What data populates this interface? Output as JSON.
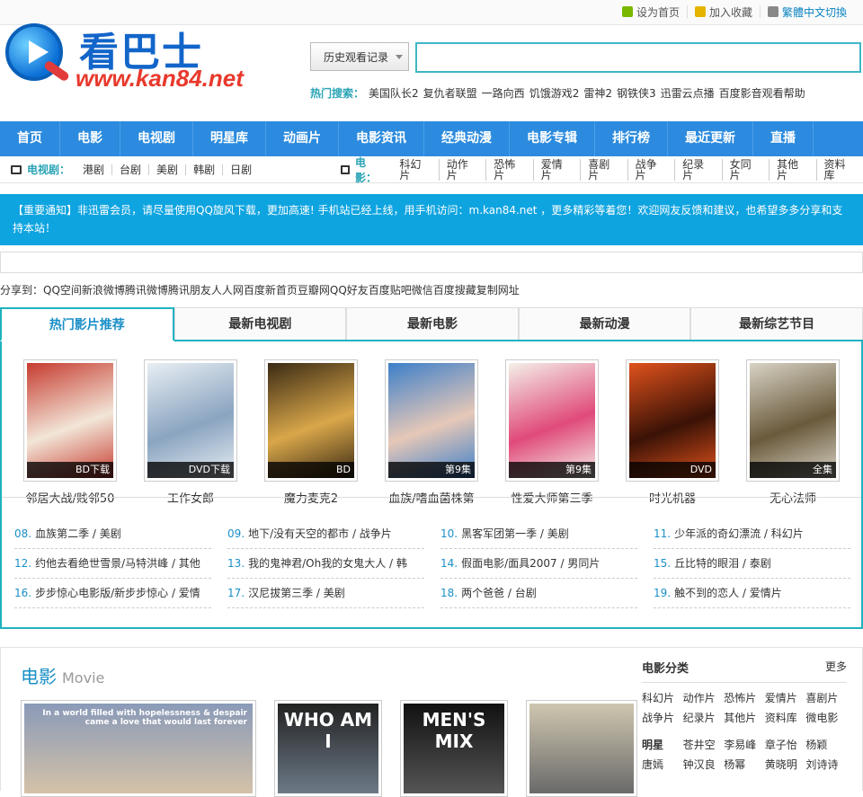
{
  "top_links": [
    {
      "label": "设为首页",
      "color": "#7ab800"
    },
    {
      "label": "加入收藏",
      "color": "#e4b400"
    },
    {
      "label": "繁體中文切換",
      "color": "#888888"
    }
  ],
  "logo": {
    "cn": "看巴士",
    "url": "www.kan84.net"
  },
  "search": {
    "history_label": "历史观看记录",
    "value": ""
  },
  "hot_search": {
    "label": "热门搜索：",
    "items": [
      "美国队长2",
      "复仇者联盟",
      "一路向西",
      "饥饿游戏2",
      "雷神2",
      "钢铁侠3",
      "迅雷云点播",
      "百度影音观看帮助"
    ]
  },
  "nav": [
    "首页",
    "电影",
    "电视剧",
    "明星库",
    "动画片",
    "电影资讯",
    "经典动漫",
    "电影专辑",
    "排行榜",
    "最近更新",
    "直播"
  ],
  "subnav": {
    "tv_label": "电视剧：",
    "tv_items": [
      "港剧",
      "台剧",
      "美剧",
      "韩剧",
      "日剧"
    ],
    "movie_label": "电影：",
    "movie_items": [
      "科幻片",
      "动作片",
      "恐怖片",
      "爱情片",
      "喜剧片",
      "战争片",
      "纪录片",
      "女同片",
      "其他片",
      "资料库"
    ]
  },
  "notice": "【重要通知】非迅雷会员，请尽量使用QQ旋风下载，更加高速! 手机站已经上线，用手机访问：m.kan84.net ，更多精彩等着您！欢迎网友反馈和建议，也希望多多分享和支持本站！",
  "share": "分享到：QQ空间新浪微博腾讯微博腾讯朋友人人网百度新首页豆瓣网QQ好友百度贴吧微信百度搜藏复制网址",
  "tabs": [
    "热门影片推荐",
    "最新电视剧",
    "最新电影",
    "最新动漫",
    "最新综艺节目"
  ],
  "posters": [
    {
      "name": "邻居大战/贱邻50",
      "tag": "BD下载",
      "c1": "#c63b2f",
      "c2": "#f2e6d8"
    },
    {
      "name": "工作女郎",
      "tag": "DVD下载",
      "c1": "#e8eef3",
      "c2": "#8aa4c0"
    },
    {
      "name": "魔力麦克2",
      "tag": "BD",
      "c1": "#3a2a14",
      "c2": "#d9a74a"
    },
    {
      "name": "血族/嗜血菌株第",
      "tag": "第9集",
      "c1": "#3d7fc9",
      "c2": "#e6c8b8"
    },
    {
      "name": "性爱大师第三季",
      "tag": "第9集",
      "c1": "#f4f0e8",
      "c2": "#e04a7a"
    },
    {
      "name": "时光机器",
      "tag": "DVD",
      "c1": "#e0521c",
      "c2": "#3a1206"
    },
    {
      "name": "无心法师",
      "tag": "全集",
      "c1": "#d8d3c5",
      "c2": "#6a5a3c"
    }
  ],
  "list_items": [
    {
      "n": "08.",
      "t": "血族第二季 / 美剧"
    },
    {
      "n": "09.",
      "t": "地下/没有天空的都市 / 战争片"
    },
    {
      "n": "10.",
      "t": "黑客军团第一季 / 美剧"
    },
    {
      "n": "11.",
      "t": "少年派的奇幻漂流 / 科幻片"
    },
    {
      "n": "12.",
      "t": "约他去看绝世雪景/马特洪峰 / 其他"
    },
    {
      "n": "13.",
      "t": "我的鬼神君/Oh我的女鬼大人 / 韩"
    },
    {
      "n": "14.",
      "t": "假面电影/面具2007 / 男同片"
    },
    {
      "n": "15.",
      "t": "丘比特的眼泪 / 泰剧"
    },
    {
      "n": "16.",
      "t": "步步惊心电影版/新步步惊心 / 爱情"
    },
    {
      "n": "17.",
      "t": "汉尼拔第三季 / 美剧"
    },
    {
      "n": "18.",
      "t": "两个爸爸 / 台剧"
    },
    {
      "n": "19.",
      "t": "触不到的恋人 / 爱情片"
    }
  ],
  "movie_section": {
    "zh": "电影",
    "en": "Movie"
  },
  "movie_posters": [
    {
      "c1": "#8a9ab8",
      "c2": "#d4c2a8",
      "text": "In a world filled with hopelessness & despair came a love that would last forever"
    },
    {
      "c1": "#222222",
      "c2": "#6c7a86",
      "text": "WHO AM I"
    },
    {
      "c1": "#111111",
      "c2": "#555555",
      "text": "MEN'S MIX"
    },
    {
      "c1": "#cfc6b0",
      "c2": "#6a6a6a",
      "text": ""
    }
  ],
  "side": {
    "title": "电影分类",
    "more": "更多",
    "rows": [
      [
        "科幻片",
        "动作片",
        "恐怖片",
        "爱情片",
        "喜剧片"
      ],
      [
        "战争片",
        "纪录片",
        "其他片",
        "资料库",
        "微电影"
      ]
    ],
    "star_label": "明星",
    "star_rows": [
      [
        "苍井空",
        "李易峰",
        "章子怡",
        "杨颖"
      ],
      [
        "唐嫣",
        "钟汉良",
        "杨幂",
        "黄晓明",
        "刘诗诗"
      ]
    ]
  }
}
